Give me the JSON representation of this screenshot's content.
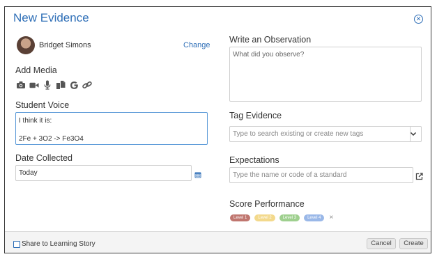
{
  "dialog": {
    "title": "New Evidence",
    "close_icon": "close-circle-icon"
  },
  "student": {
    "name": "Bridget Simons",
    "change_label": "Change"
  },
  "add_media": {
    "label": "Add Media",
    "icons": [
      "camera-icon",
      "video-icon",
      "microphone-icon",
      "documents-icon",
      "google-icon",
      "link-icon"
    ]
  },
  "student_voice": {
    "label": "Student Voice",
    "lines": [
      "I think it is:",
      "",
      "2Fe + 3O2 -> Fe3O4"
    ]
  },
  "date_collected": {
    "label": "Date Collected",
    "value": "Today",
    "icon": "calendar-icon"
  },
  "observation": {
    "label": "Write an Observation",
    "placeholder": "What did you observe?"
  },
  "tag_evidence": {
    "label": "Tag Evidence",
    "placeholder": "Type to search existing or create new tags",
    "icon": "chevron-down-icon"
  },
  "expectations": {
    "label": "Expectations",
    "placeholder": "Type the name or code of a standard",
    "icon": "external-link-icon"
  },
  "score_performance": {
    "label": "Score Performance",
    "levels": [
      {
        "label": "Level 1",
        "color": "#c0766f"
      },
      {
        "label": "Level 2",
        "color": "#f3d98c"
      },
      {
        "label": "Level 3",
        "color": "#9fd08f"
      },
      {
        "label": "Level 4",
        "color": "#9ab8e8"
      }
    ],
    "clear_label": "×"
  },
  "footer": {
    "share_label": "Share to Learning Story",
    "share_checked": false,
    "cancel_label": "Cancel",
    "create_label": "Create"
  }
}
